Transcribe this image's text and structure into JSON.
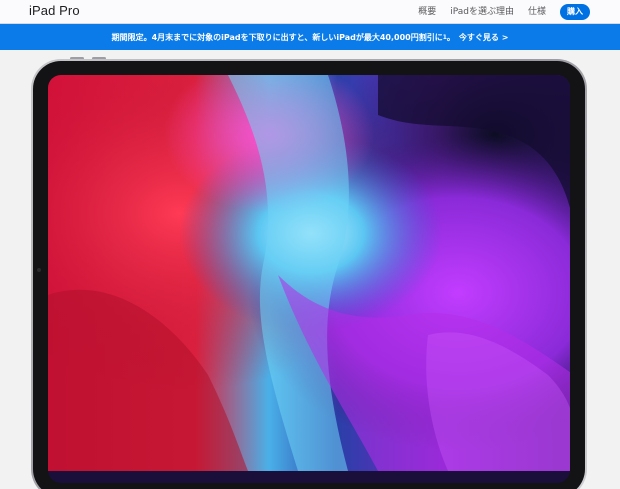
{
  "localnav": {
    "title": "iPad Pro",
    "links": [
      "概要",
      "iPadを選ぶ理由",
      "仕様"
    ],
    "buy_label": "購入"
  },
  "ribbon": {
    "text": "期間限定。4月末までに対象のiPadを下取りに出すと、新しいiPadが最大40,000円割引に",
    "footnote": "1",
    "link_label": "今すぐ見る >"
  },
  "colors": {
    "accent": "#0071e3",
    "ribbon": "#0a7be8"
  },
  "icons": {
    "hero": "ipad-pro-wallpaper"
  }
}
